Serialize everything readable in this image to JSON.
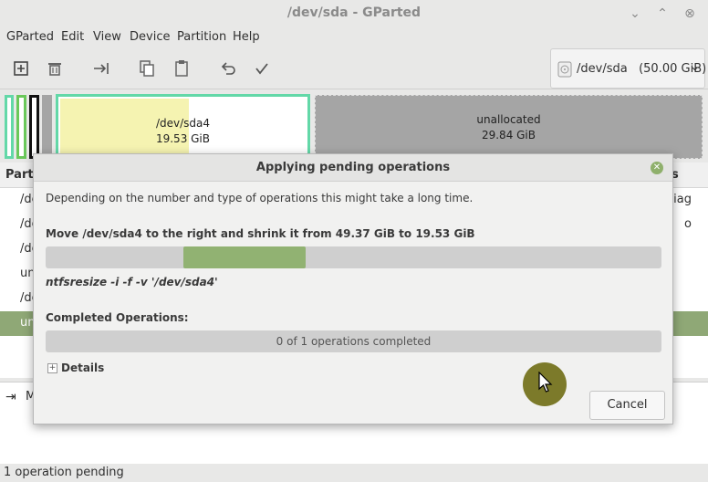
{
  "window": {
    "title": "/dev/sda - GParted",
    "minimize_glyph": "⌄",
    "maximize_glyph": "⌃",
    "close_glyph": "⊗"
  },
  "menu": [
    "GParted",
    "Edit",
    "View",
    "Device",
    "Partition",
    "Help"
  ],
  "toolbar": {
    "icons": [
      "new-partition-icon",
      "delete-icon",
      "resize-move-icon",
      "copy-icon",
      "paste-icon",
      "undo-icon",
      "apply-icon"
    ],
    "device_label": "/dev/sda   (50.00 GiB)"
  },
  "partition_map": {
    "sda4": {
      "name": "/dev/sda4",
      "size": "19.53 GiB"
    },
    "unallocated": {
      "name": "unallocated",
      "size": "29.84 GiB"
    }
  },
  "list": {
    "header_left": "Partiti",
    "header_right": "s",
    "rows": [
      {
        "c0": "/de",
        "c9": "iag"
      },
      {
        "c0": "/de",
        "c9": "o"
      },
      {
        "c0": "/de",
        "c9": ""
      },
      {
        "c0": "una",
        "c9": ""
      },
      {
        "c0": "/de",
        "c9": ""
      },
      {
        "c0": "una",
        "c9": ""
      }
    ]
  },
  "ops_pane": {
    "text": "M"
  },
  "status": "1 operation pending",
  "dialog": {
    "title": "Applying pending operations",
    "description": "Depending on the number and type of operations this might take a long time.",
    "operation": "Move /dev/sda4 to the right and shrink it from 49.37 GiB to 19.53 GiB",
    "command": "ntfsresize -i -f -v '/dev/sda4'",
    "completed_label": "Completed Operations:",
    "completed_text": "0 of 1 operations completed",
    "details_label": "Details",
    "details_expander": "+",
    "cancel_label": "Cancel",
    "close_glyph": "✕"
  }
}
